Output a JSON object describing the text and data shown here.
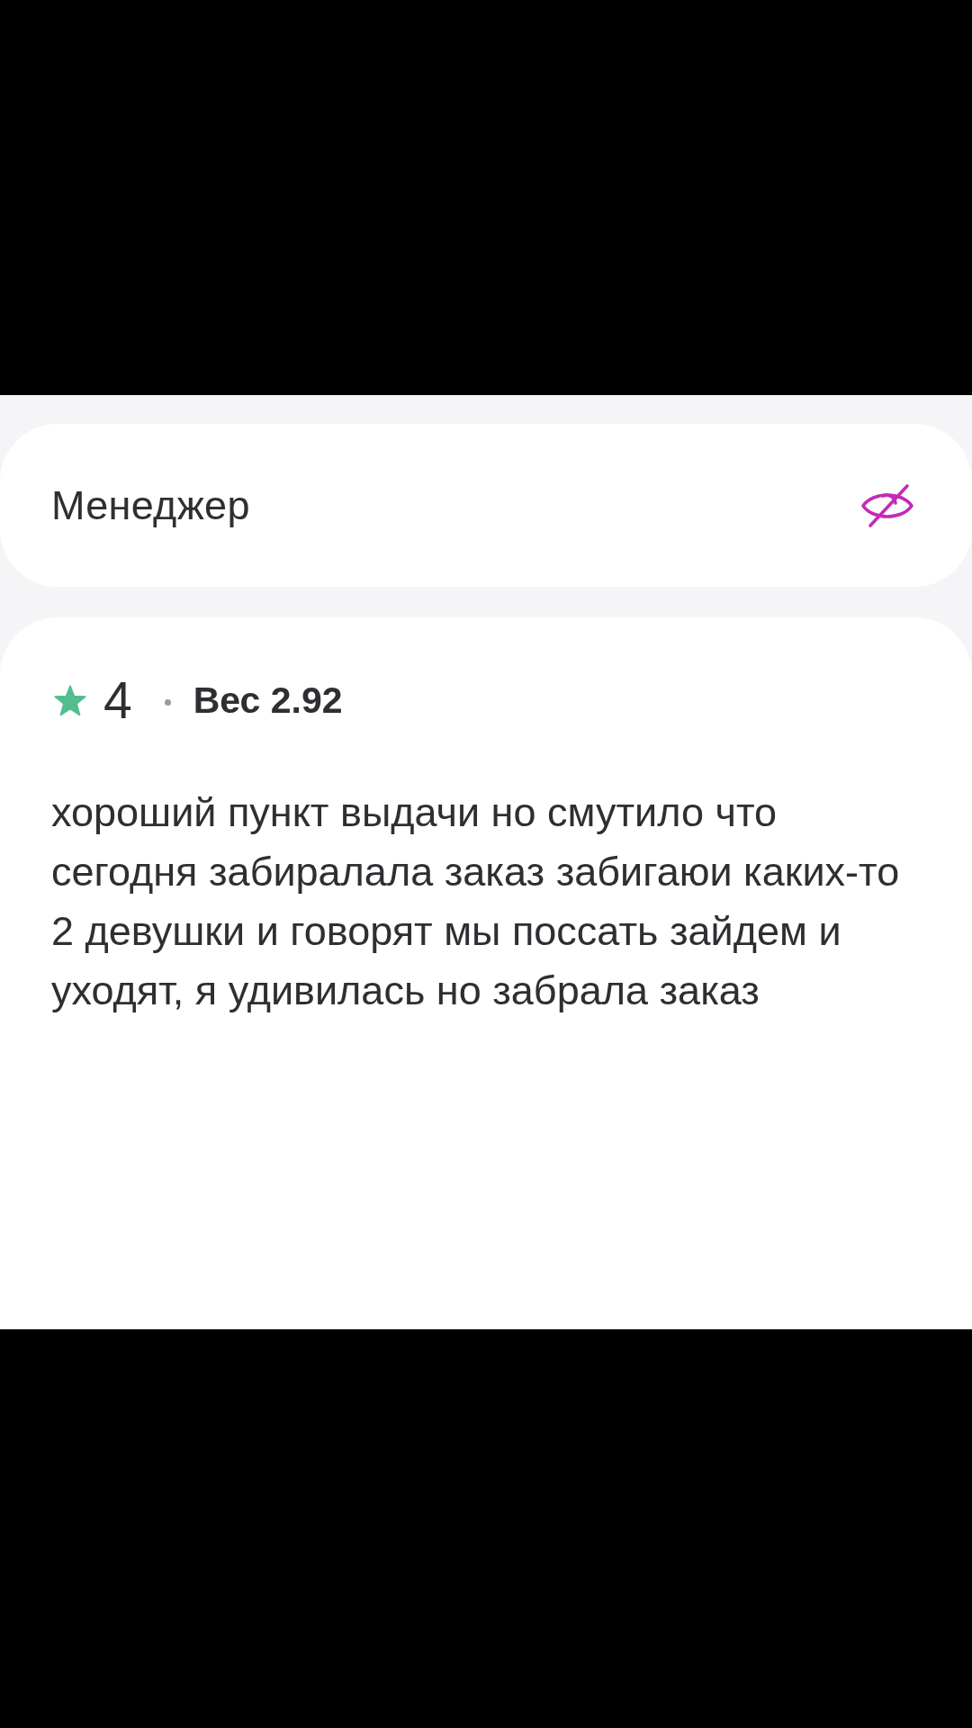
{
  "manager_card": {
    "title": "Менеджер"
  },
  "review": {
    "rating": "4",
    "weight": "Вес 2.92",
    "text": "хороший пункт выдачи но смутило что сегодня забиралала заказ забигаюи каких-то 2 девушки и говорят мы поссать зайдем и уходят, я удивилась но забрала заказ"
  }
}
